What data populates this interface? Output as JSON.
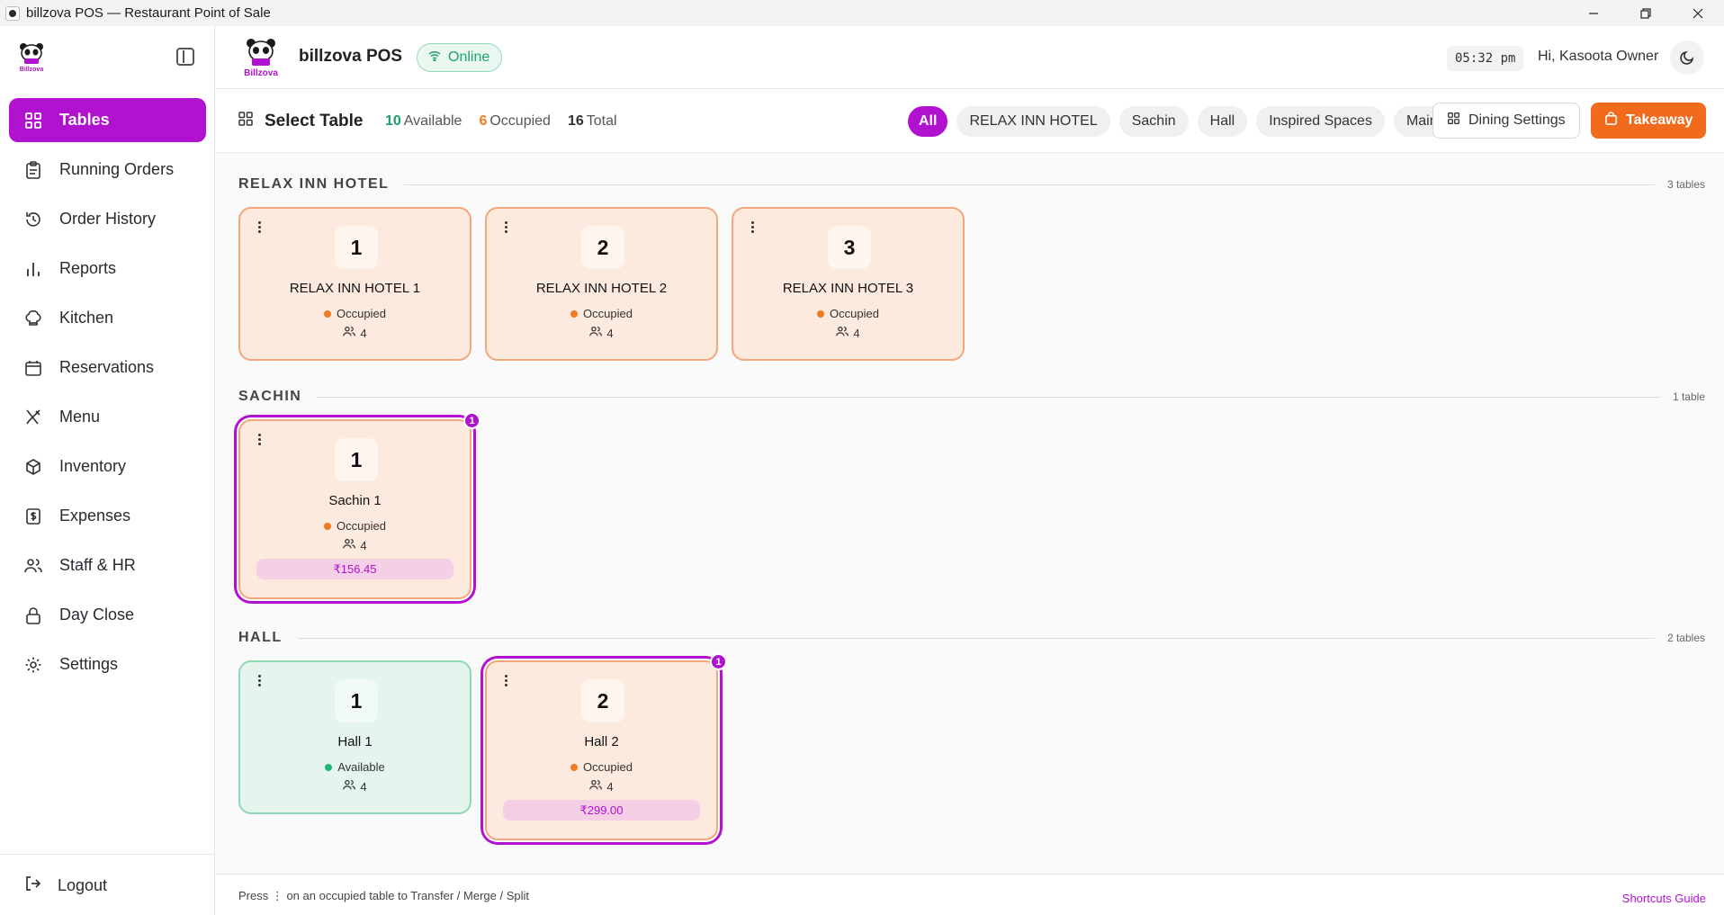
{
  "window": {
    "title": "billzova POS — Restaurant Point of Sale"
  },
  "sidebar": {
    "logo_text": "Billzova",
    "items": [
      {
        "label": "Tables",
        "icon": "grid-icon",
        "active": true
      },
      {
        "label": "Running Orders",
        "icon": "clipboard-icon"
      },
      {
        "label": "Order History",
        "icon": "history-icon"
      },
      {
        "label": "Reports",
        "icon": "bar-chart-icon"
      },
      {
        "label": "Kitchen",
        "icon": "chef-hat-icon"
      },
      {
        "label": "Reservations",
        "icon": "calendar-icon"
      },
      {
        "label": "Menu",
        "icon": "utensils-icon"
      },
      {
        "label": "Inventory",
        "icon": "package-icon"
      },
      {
        "label": "Expenses",
        "icon": "receipt-icon"
      },
      {
        "label": "Staff & HR",
        "icon": "users-icon"
      },
      {
        "label": "Day Close",
        "icon": "lock-icon"
      },
      {
        "label": "Settings",
        "icon": "gear-icon"
      }
    ],
    "logout_label": "Logout"
  },
  "header": {
    "brand_name": "billzova POS",
    "logo_text": "Billzova",
    "status": "Online",
    "time": "05:32 pm",
    "greeting": "Hi, Kasoota Owner"
  },
  "toolbar": {
    "title": "Select Table",
    "stats": {
      "available_count": "10",
      "available_label": "Available",
      "occupied_count": "6",
      "occupied_label": "Occupied",
      "total_count": "16",
      "total_label": "Total"
    },
    "filters": [
      "All",
      "RELAX INN HOTEL",
      "Sachin",
      "Hall",
      "Inspired Spaces",
      "Main"
    ],
    "active_filter": "All",
    "dining_settings_label": "Dining Settings",
    "takeaway_label": "Takeaway"
  },
  "sections": [
    {
      "name": "RELAX INN HOTEL",
      "count": "3 tables",
      "tables": [
        {
          "number": "1",
          "name": "RELAX INN HOTEL 1",
          "status": "Occupied",
          "seats": "4"
        },
        {
          "number": "2",
          "name": "RELAX INN HOTEL 2",
          "status": "Occupied",
          "seats": "4"
        },
        {
          "number": "3",
          "name": "RELAX INN HOTEL 3",
          "status": "Occupied",
          "seats": "4"
        }
      ]
    },
    {
      "name": "SACHIN",
      "count": "1 table",
      "tables": [
        {
          "number": "1",
          "name": "Sachin 1",
          "status": "Occupied",
          "seats": "4",
          "amount": "₹156.45",
          "badge": "1"
        }
      ]
    },
    {
      "name": "HALL",
      "count": "2 tables",
      "tables": [
        {
          "number": "1",
          "name": "Hall 1",
          "status": "Available",
          "seats": "4"
        },
        {
          "number": "2",
          "name": "Hall 2",
          "status": "Occupied",
          "seats": "4",
          "amount": "₹299.00",
          "badge": "1"
        }
      ]
    }
  ],
  "footer": {
    "hint": "Press ⋮ on an occupied table to Transfer / Merge / Split",
    "shortcuts_label": "Shortcuts Guide"
  },
  "colors": {
    "accent": "#b012cf",
    "takeaway": "#f26a1b",
    "occupied": "#ee7a22",
    "available": "#1fb574"
  }
}
